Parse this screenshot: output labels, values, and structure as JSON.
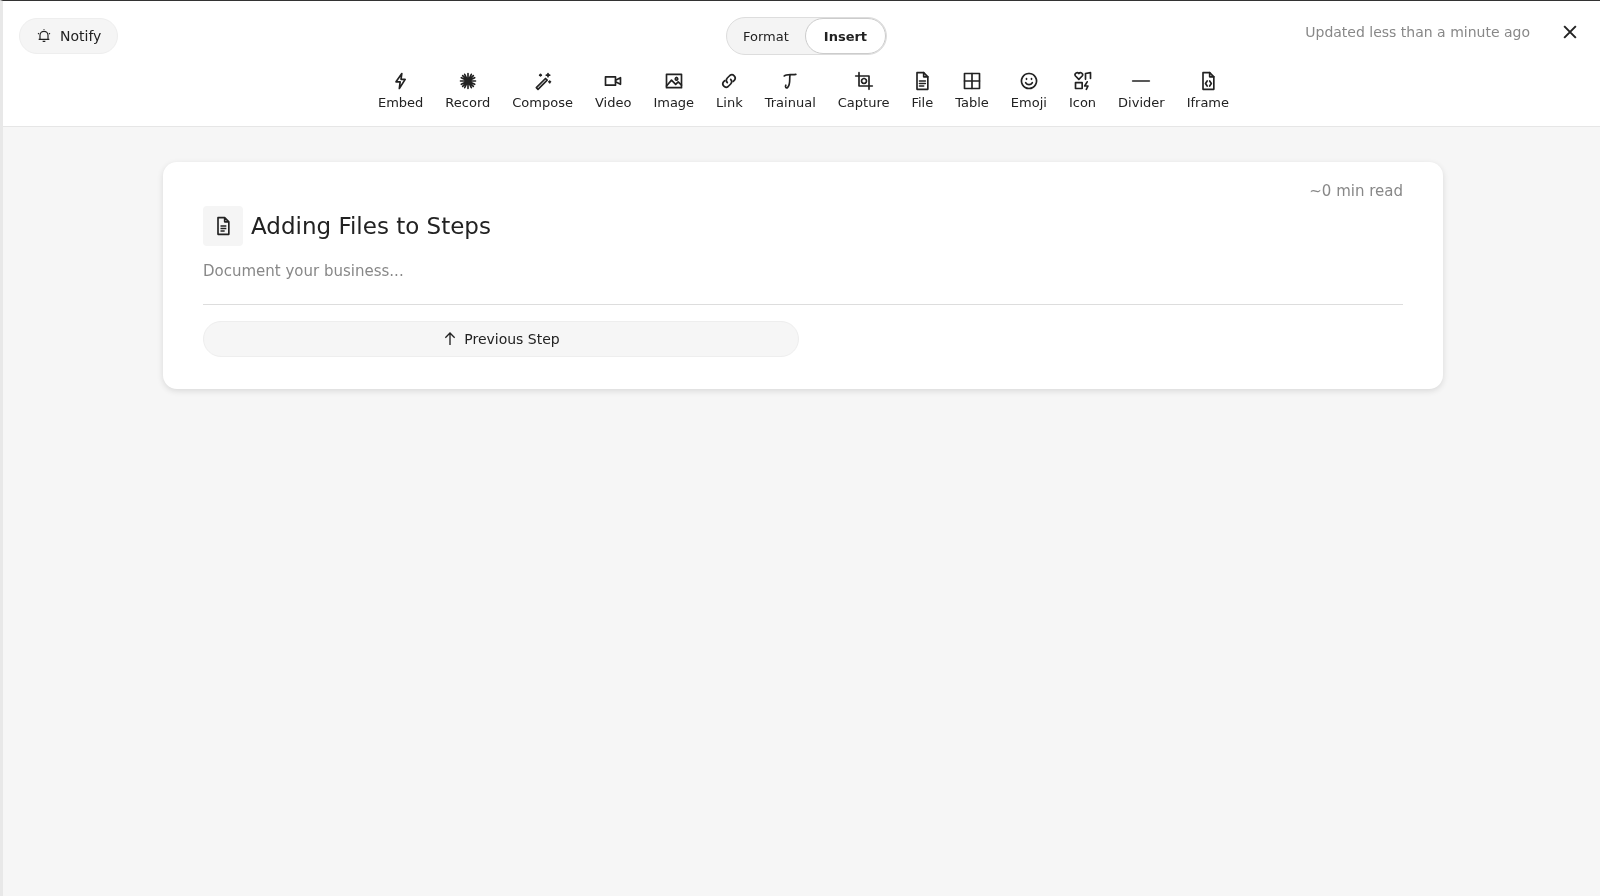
{
  "notify_button": {
    "label": "Notify"
  },
  "mode_tabs": [
    {
      "label": "Format",
      "selected": false
    },
    {
      "label": "Insert",
      "selected": true
    }
  ],
  "status": "Updated less than a minute ago",
  "toolbar": [
    {
      "kind": "embed",
      "label": "Embed"
    },
    {
      "kind": "record",
      "label": "Record"
    },
    {
      "kind": "compose",
      "label": "Compose"
    },
    {
      "kind": "video",
      "label": "Video"
    },
    {
      "kind": "image",
      "label": "Image"
    },
    {
      "kind": "link",
      "label": "Link"
    },
    {
      "kind": "trainual",
      "label": "Trainual"
    },
    {
      "kind": "capture",
      "label": "Capture"
    },
    {
      "kind": "file",
      "label": "File"
    },
    {
      "kind": "table",
      "label": "Table"
    },
    {
      "kind": "emoji",
      "label": "Emoji"
    },
    {
      "kind": "icon",
      "label": "Icon"
    },
    {
      "kind": "divider",
      "label": "Divider"
    },
    {
      "kind": "iframe",
      "label": "Iframe"
    }
  ],
  "step": {
    "read_time": "~0 min read",
    "title": "Adding Files to Steps",
    "placeholder": "Document your business...",
    "previous_button": "Previous Step"
  }
}
